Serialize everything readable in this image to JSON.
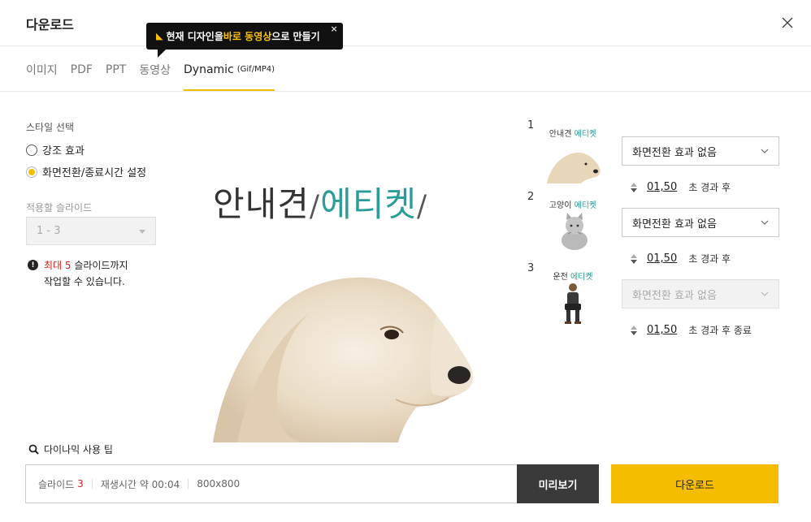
{
  "header": {
    "title": "다운로드"
  },
  "tooltip": {
    "prefix": "현재 디자인을 ",
    "highlight": "바로 동영상",
    "suffix": "으로 만들기",
    "close": "×"
  },
  "tabs": [
    {
      "label": "이미지"
    },
    {
      "label": "PDF"
    },
    {
      "label": "PPT"
    },
    {
      "label": "동영상"
    },
    {
      "label": "Dynamic",
      "sub": "(Gif/MP4)"
    }
  ],
  "style_section": {
    "label": "스타일 선택",
    "options": [
      {
        "label": "강조 효과",
        "checked": false
      },
      {
        "label": "화면전환/종료시간 설정",
        "checked": true
      }
    ]
  },
  "slides_section": {
    "label": "적용할 슬라이드",
    "range": "1 - 3"
  },
  "notice": {
    "icon": "!",
    "red": "최대 5",
    "line1_rest": " 슬라이드까지",
    "line2": "작업할 수 있습니다."
  },
  "tips": {
    "label": "다이나믹 사용 팁"
  },
  "preview": {
    "title_dark": "안내견",
    "title_teal": "에티켓"
  },
  "slides": [
    {
      "number": "1",
      "thumb_dark": "안내견 ",
      "thumb_teal": "에티켓",
      "transition": "화면전환 효과 없음",
      "disabled": false,
      "time": "01,50",
      "suffix": "초 경과 후"
    },
    {
      "number": "2",
      "thumb_dark": "고양이 ",
      "thumb_teal": "에티켓",
      "transition": "화면전환 효과 없음",
      "disabled": false,
      "time": "01,50",
      "suffix": "초 경과 후"
    },
    {
      "number": "3",
      "thumb_dark": "운전 ",
      "thumb_teal": "에티켓",
      "transition": "화면전환 효과 없음",
      "disabled": true,
      "time": "01,50",
      "suffix": "초 경과 후 종료"
    }
  ],
  "footer": {
    "slides_label": "슬라이드",
    "slides_count": "3",
    "duration": "재생시간 약 00:04",
    "resolution": "800x800",
    "preview_button": "미리보기",
    "download_button": "다운로드"
  },
  "colors": {
    "accent": "#f5bd00",
    "teal": "#2a9d98",
    "red": "#e02020"
  }
}
